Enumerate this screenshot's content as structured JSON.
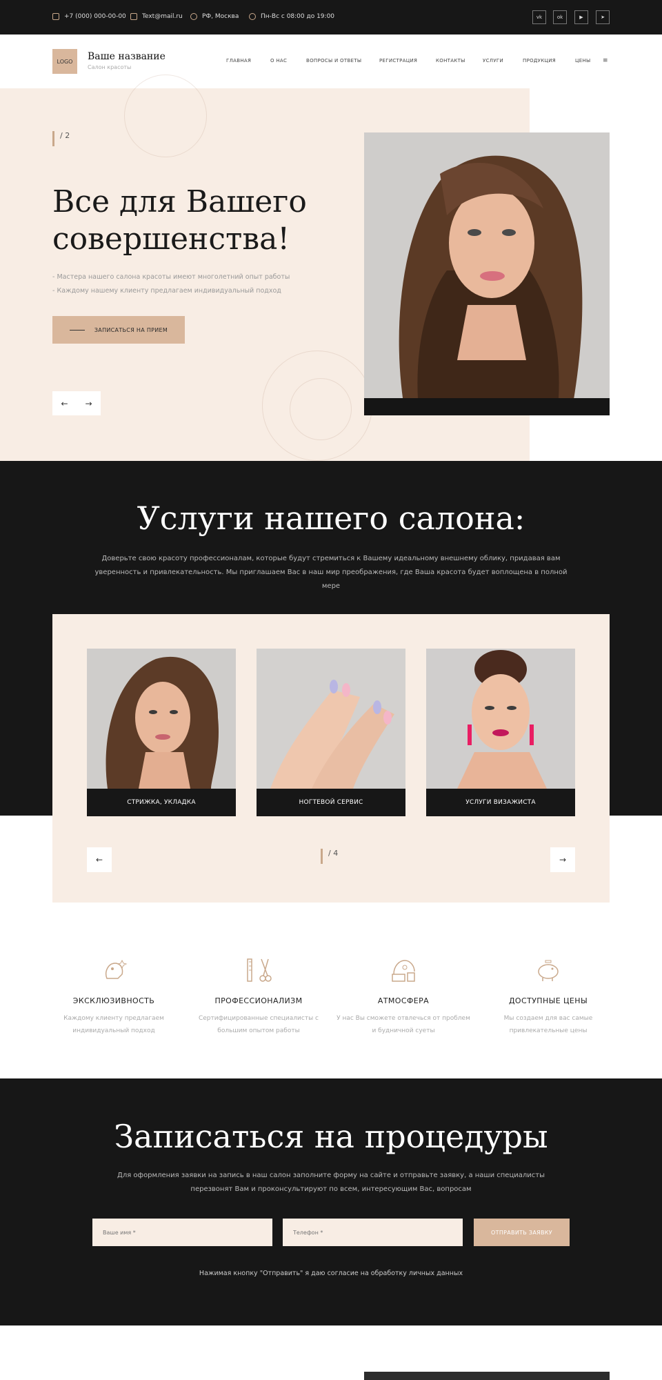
{
  "topbar": {
    "phone": "+7 (000) 000-00-00",
    "email": "Text@mail.ru",
    "location": "РФ, Москва",
    "hours": "Пн-Вс с 08:00 до 19:00",
    "socials": [
      "vk-icon",
      "odnoklassniki-icon",
      "youtube-icon",
      "telegram-icon"
    ]
  },
  "header": {
    "logo": "LOGO",
    "brand": "Ваше название",
    "subtitle": "Салон красоты",
    "nav": [
      "ГЛАВНАЯ",
      "О НАС",
      "ВОПРОСЫ И ОТВЕТЫ",
      "РЕГИСТРАЦИЯ",
      "КОНТАКТЫ",
      "УСЛУГИ",
      "ПРОДУКЦИЯ",
      "ЦЕНЫ"
    ],
    "menu_icon": "≡"
  },
  "hero": {
    "counter": "/ 2",
    "title": "Все для Вашего совершенства!",
    "points": [
      "- Мастера нашего салона красоты имеют многолетний опыт работы",
      "- Каждому нашему клиенту предлагаем индивидуальный подход"
    ],
    "cta": "ЗАПИСАТЬСЯ НА ПРИЕМ",
    "prev": "←",
    "next": "→"
  },
  "services": {
    "title": "Услуги нашего салона:",
    "description": "Доверьте свою красоту профессионалам, которые будут стремиться к Вашему идеальному внешнему облику, придавая вам уверенность и привлекательность. Мы приглашаем Вас в наш мир преображения, где Ваша красота будет воплощена в полной мере",
    "cards": [
      "СТРИЖКА, УКЛАДКА",
      "НОГТЕВОЙ СЕРВИС",
      "УСЛУГИ ВИЗАЖИСТА"
    ],
    "counter": "/ 4",
    "prev": "←",
    "next": "→"
  },
  "features": [
    {
      "title": "ЭКСКЛЮЗИВНОСТЬ",
      "line1": "Каждому клиенту предлагаем",
      "line2": "индивидуальный подход",
      "icon": "pet-care-icon"
    },
    {
      "title": "ПРОФЕССИОНАЛИЗМ",
      "line1": "Сертифицированные специалисты с",
      "line2": "большим опытом работы",
      "icon": "hairdresser-tools-icon"
    },
    {
      "title": "АТМОСФЕРА",
      "line1": "У нас Вы сможете отвлечься от проблем",
      "line2": "и будничной суеты",
      "icon": "salon-interior-icon"
    },
    {
      "title": "ДОСТУПНЫЕ ЦЕНЫ",
      "line1": "Мы создаем для вас самые",
      "line2": "привлекательные цены",
      "icon": "piggy-bank-icon"
    }
  ],
  "booking": {
    "title": "Записаться на процедуры",
    "line1": "Для оформления заявки на запись в наш салон заполните форму на сайте и отправьте заявку, а наши специалисты",
    "line2": "перезвонят Вам и проконсультируют по всем, интересующим Вас, вопросам",
    "name_placeholder": "Ваше имя *",
    "phone_placeholder": "Телефон *",
    "submit": "ОТПРАВИТЬ ЗАЯВКУ",
    "consent": "Нажимая кнопку \"Отправить\" я даю согласие на обработку личных данных"
  },
  "colors": {
    "accent": "#d9b79c",
    "dark": "#171717",
    "cream": "#f8ede4"
  }
}
